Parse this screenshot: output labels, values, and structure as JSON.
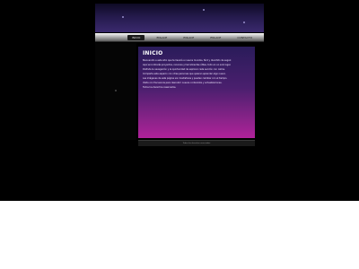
{
  "nav": {
    "items": [
      "INICIO",
      "ENLACE",
      "ENLACE",
      "ENLACE",
      "CONTACTO"
    ],
    "active_index": 0
  },
  "content": {
    "title": "INICIO",
    "paragraphs": [
      "Bienvenido a este sitio que te llevará a nuevos mundos, fácil y divertido de seguir.",
      "Aquí encontrarás proyectos, recursos y herramientas útiles, todo en un solo lugar.",
      "Disfruta la navegación y la oportunidad de explorar cada sección con calma.",
      "Comparte este espacio con otras personas que quieran aprender algo nuevo.",
      "Las imágenes de esta página son ilustrativas y pueden cambiar con el tiempo.",
      "Visita con frecuencia para descubrir nuevos contenidos y actualizaciones.",
      "Todos los derechos reservados."
    ]
  },
  "footer": {
    "text": "Todos los derechos reservados"
  },
  "colors": {
    "background": "#000000",
    "content_top": "#2a1c5a",
    "content_bottom": "#b0219a",
    "nav_active": "#1b1b1b"
  }
}
